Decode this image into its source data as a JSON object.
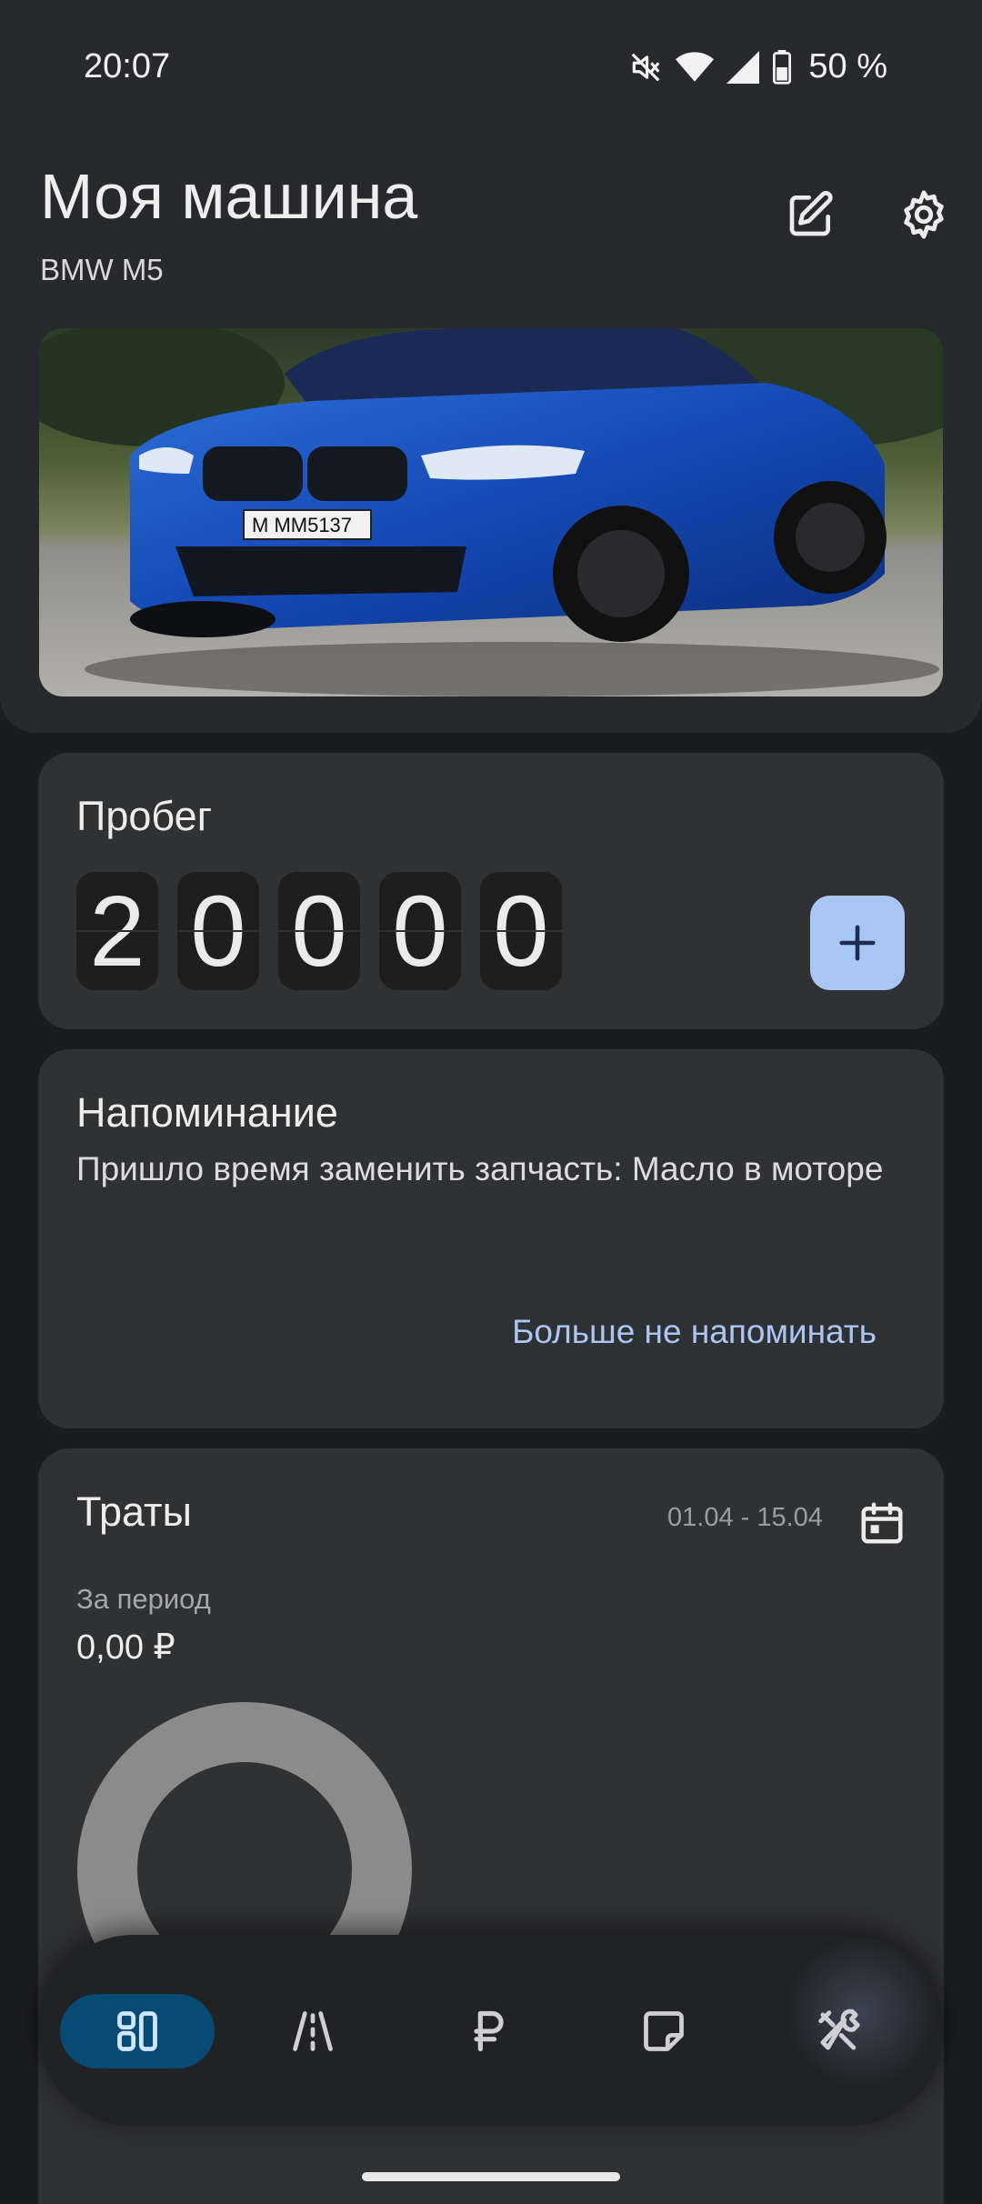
{
  "status_bar": {
    "time": "20:07",
    "battery_percent": "50 %",
    "icons": [
      "mute-icon",
      "wifi-icon",
      "signal-icon",
      "battery-icon"
    ]
  },
  "header": {
    "title": "Моя машина",
    "subtitle": "BMW M5",
    "actions": [
      "edit-icon",
      "settings-icon"
    ],
    "photo_plate": "M MM5137"
  },
  "mileage": {
    "title": "Пробег",
    "digits": [
      "2",
      "0",
      "0",
      "0",
      "0"
    ],
    "add_icon": "plus-icon"
  },
  "reminder": {
    "title": "Напоминание",
    "text": "Пришло время заменить запчасть: Масло в моторе",
    "action_label": "Больше не напоминать"
  },
  "expenses": {
    "title": "Траты",
    "period_range": "01.04 - 15.04",
    "period_label": "За период",
    "total": "0,00 ₽",
    "calendar_icon": "calendar-icon"
  },
  "bottom_nav": {
    "items": [
      {
        "icon": "dashboard-icon",
        "active": true
      },
      {
        "icon": "road-icon",
        "active": false
      },
      {
        "icon": "ruble-icon",
        "active": false
      },
      {
        "icon": "note-icon",
        "active": false
      },
      {
        "icon": "tools-icon",
        "active": false
      }
    ]
  },
  "colors": {
    "accent": "#a9c6f5",
    "nav_active": "#074a73",
    "card_bg": "#303133",
    "screen_bg": "#1b1c1e"
  }
}
